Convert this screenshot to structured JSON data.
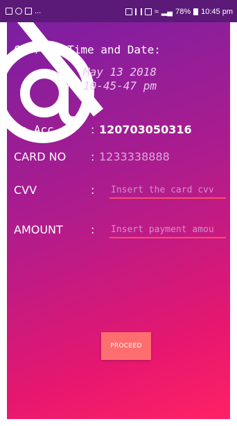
{
  "status_bar": {
    "left_icons": [
      "image-icon",
      "at-icon",
      "image-icon"
    ],
    "overflow_text": "...",
    "battery": "78%",
    "time": "10:45 pm"
  },
  "header": {
    "title": "Current Time and Date:",
    "date": "May 13 2018",
    "time": "10-45-47 pm"
  },
  "form": {
    "to_acc": {
      "label": "To Acc",
      "colon": ":",
      "value": "120703050316"
    },
    "card_no": {
      "label": "CARD NO",
      "colon": ":",
      "value": "1233338888"
    },
    "cvv": {
      "label": "CVV",
      "colon": ":",
      "placeholder": "Insert the card cvv"
    },
    "amount": {
      "label": "AMOUNT",
      "colon": ":",
      "placeholder": "Insert payment amou"
    }
  },
  "proceed_label": "PROCEED",
  "colors": {
    "status_bar": "#5b1a78",
    "gradient_start": "#7b1fa2",
    "gradient_end": "#ff2165",
    "underline": "#ff4d6d",
    "button": "#ff6e6e"
  }
}
